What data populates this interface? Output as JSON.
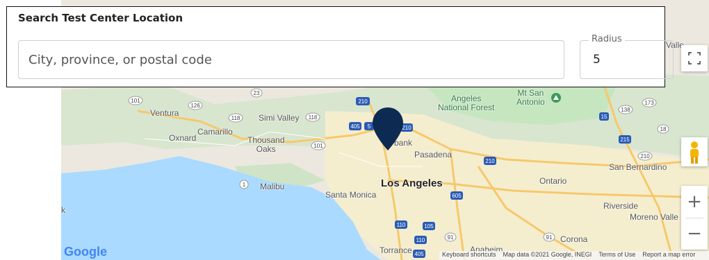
{
  "search": {
    "title": "Search Test Center Location",
    "city_placeholder": "City, province, or postal code",
    "city_value": "",
    "radius_label": "Radius",
    "radius_value": "5"
  },
  "map": {
    "labels": {
      "ventura": "Ventura",
      "oxnard": "Oxnard",
      "camarillo": "Camarillo",
      "simi_valley": "Simi Valley",
      "thousand_oaks": "Thousand\nOaks",
      "malibu": "Malibu",
      "santa_monica": "Santa Monica",
      "los_angeles": "Los Angeles",
      "pasadena": "Pasadena",
      "burbank": "bank",
      "angeles_nf": "Angeles\nNational Forest",
      "mt_san_antonio": "Mt San\nAntonio",
      "ontario": "Ontario",
      "san_bernardino": "San Bernardino",
      "riverside": "Riverside",
      "moreno_valley": "Moreno Valle",
      "corona": "Corona",
      "torrance": "Torrance",
      "anaheim": "Anaheim",
      "k": "k",
      "valle_top": "Valle"
    },
    "shields": [
      "101",
      "126",
      "118",
      "118",
      "23",
      "101",
      "210",
      "405",
      "5",
      "210",
      "15",
      "138",
      "173",
      "18",
      "15",
      "210",
      "210",
      "1",
      "605",
      "110",
      "105",
      "91",
      "110",
      "405",
      "91"
    ],
    "google_logo": "Google",
    "attribution": {
      "shortcuts": "Keyboard shortcuts",
      "data": "Map data ©2021 Google, INEGI",
      "terms": "Terms of Use",
      "report": "Report a map error"
    },
    "controls": {
      "zoom_in": "+",
      "zoom_out": "−"
    },
    "colors": {
      "water": "#aadaff",
      "land": "#ece8df",
      "park": "#c6e6bf",
      "urban": "#f4eecf",
      "marker": "#0d2b52"
    }
  }
}
